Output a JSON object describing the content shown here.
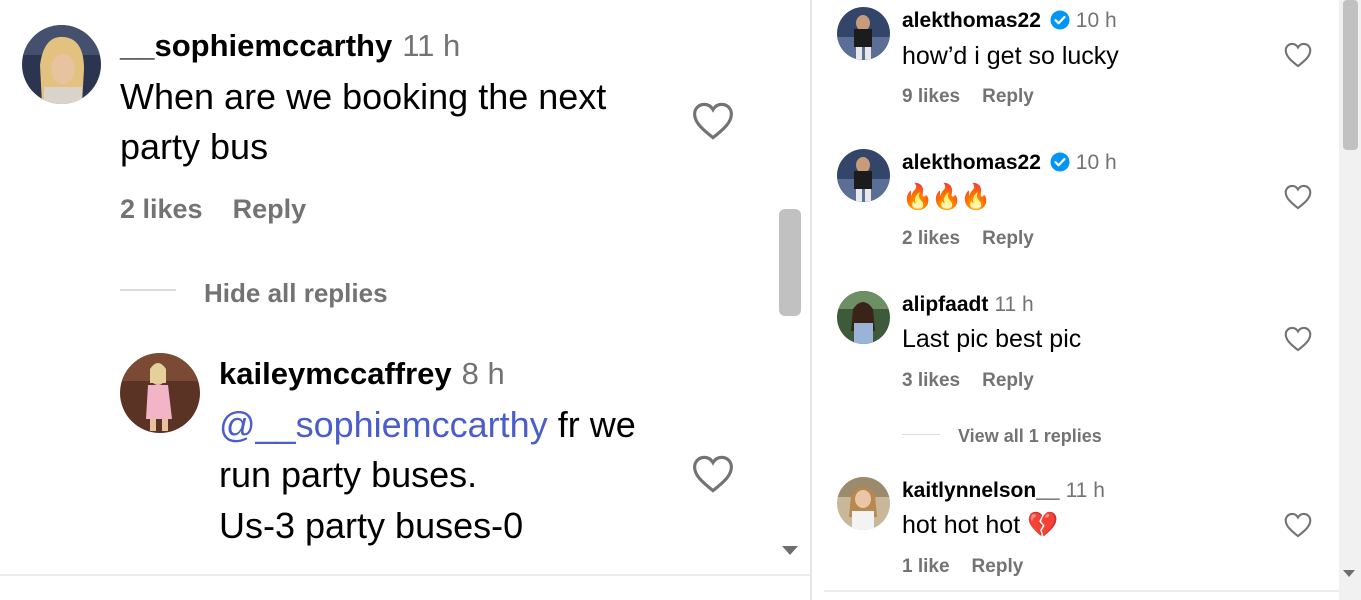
{
  "left": {
    "comment": {
      "username": "__sophiemccarthy",
      "time": "11 h",
      "text_line1": "When are we booking the next",
      "text_line2": "party bus",
      "likes": "2 likes",
      "reply": "Reply"
    },
    "hide_replies": "Hide all replies",
    "reply": {
      "username": "kaileymccaffrey",
      "time": "8 h",
      "mention": "@__sophiemccarthy",
      "line1_rest": " fr we",
      "line2": "run party buses.",
      "line3": "Us-3 party buses-0"
    }
  },
  "right": {
    "comments": [
      {
        "username": "alekthomas22",
        "verified": true,
        "time": "10 h",
        "text": "how’d i get so lucky",
        "likes": "9 likes",
        "reply": "Reply"
      },
      {
        "username": "alekthomas22",
        "verified": true,
        "time": "10 h",
        "text": "🔥🔥🔥",
        "likes": "2 likes",
        "reply": "Reply"
      },
      {
        "username": "alipfaadt",
        "verified": false,
        "time": "11 h",
        "text": "Last pic best pic",
        "likes": "3 likes",
        "reply": "Reply"
      },
      {
        "username": "kaitlynnelson__",
        "verified": false,
        "time": "11 h",
        "text": "hot hot hot 💔",
        "likes": "1 like",
        "reply": "Reply"
      }
    ],
    "view_replies": "View all 1 replies"
  },
  "colors": {
    "mention": "#4a5dc9",
    "verified": "#0095f6",
    "muted": "#737373"
  }
}
